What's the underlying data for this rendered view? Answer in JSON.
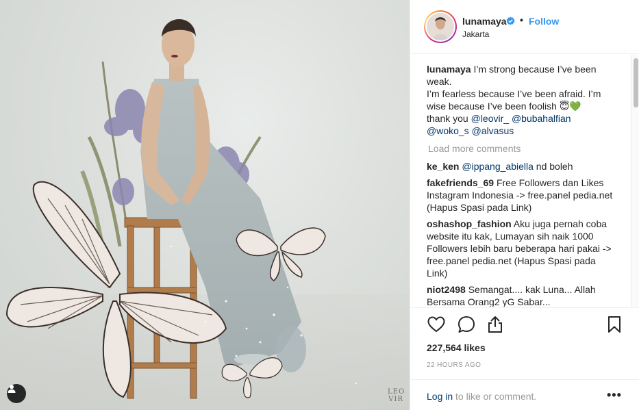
{
  "post": {
    "username": "lunamaya",
    "follow_label": "Follow",
    "separator": "•",
    "location": "Jakarta",
    "watermark_line1": "LEO",
    "watermark_line2": "VIR"
  },
  "caption": {
    "username": "lunamaya",
    "line1": " I’m strong because I’ve been weak.",
    "line2": "I’m fearless because I’ve been afraid. I’m wise because I’ve been foolish 😇💚",
    "line3_prefix": "thank you ",
    "mention1": "@leovir_",
    "mention2": " @bubahalfian",
    "mention3": "@woko_s",
    "mention4": " @alvasus"
  },
  "load_more": "Load more comments",
  "comments": [
    {
      "user": "ke_ken",
      "mention": "@ippang_abiella",
      "text": " nd boleh"
    },
    {
      "user": "fakefriends_69",
      "text": " Free Followers dan Likes Instagram Indonesia -> free.panel pedia.net (Hapus Spasi pada Link)"
    },
    {
      "user": "oshashop_fashion",
      "text": " Aku juga pernah coba website itu kak, Lumayan sih naik 1000 Followers lebih baru beberapa hari pakai -> free.panel pedia.net (Hapus Spasi pada Link)"
    },
    {
      "user": "niot2498",
      "text": " Semangat.... kak Luna... Allah Bersama Orang2 yG Sabar..."
    }
  ],
  "likes": "227,564 likes",
  "timestamp": "22 HOURS AGO",
  "login_prompt": {
    "link": "Log in",
    "rest": " to like or comment."
  },
  "more_options": "•••",
  "colors": {
    "link_blue": "#3897f0",
    "mention": "#003569",
    "muted": "#999999",
    "verified": "#3897f0"
  },
  "icons": [
    "user-tag-icon",
    "verified-badge-icon",
    "heart-icon",
    "comment-icon",
    "share-icon",
    "bookmark-icon",
    "more-options-icon"
  ]
}
